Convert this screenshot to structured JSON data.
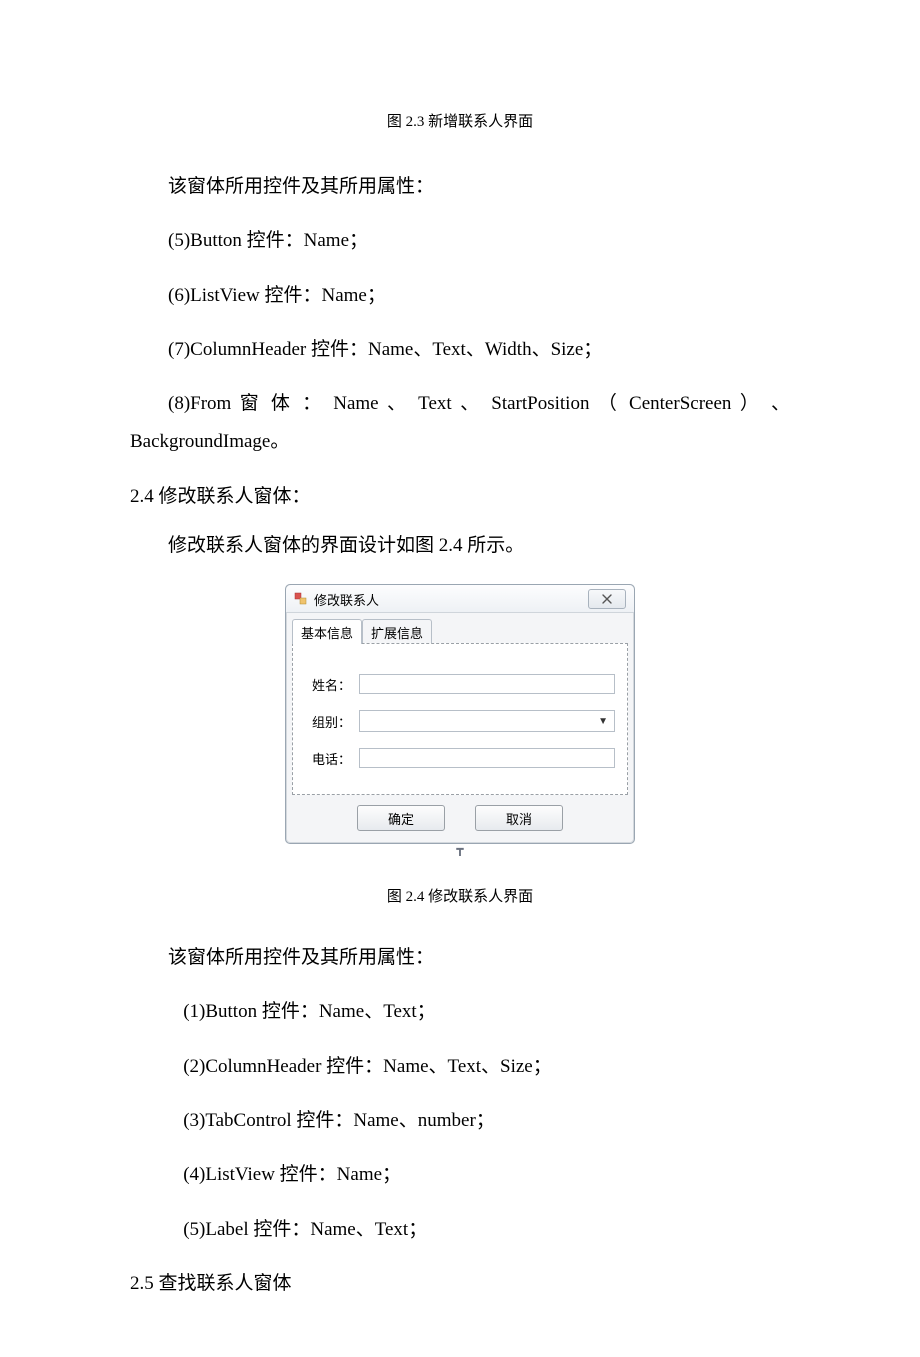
{
  "captions": {
    "fig23": "图 2.3  新增联系人界面",
    "fig24": "图 2.4    修改联系人界面"
  },
  "paras": {
    "p1": "该窗体所用控件及其所用属性：",
    "p2": "(5)Button 控件：Name；",
    "p3": "(6)ListView 控件：Name；",
    "p4": "(7)ColumnHeader 控件：Name、Text、Width、Size；",
    "p5a": "(8)From   窗 体 ：   Name  、  Text  、  StartPosition   （  CenterScreen  ） 、",
    "p5b": "BackgroundImage。",
    "s24": "2.4 修改联系人窗体：",
    "p6": "修改联系人窗体的界面设计如图 2.4 所示。",
    "p7": "该窗体所用控件及其所用属性：",
    "p8": "(1)Button 控件：Name、Text；",
    "p9": "(2)ColumnHeader 控件：Name、Text、Size；",
    "p10": "(3)TabControl 控件：Name、number；",
    "p11": "(4)ListView 控件：Name；",
    "p12": "(5)Label 控件：Name、Text；",
    "s25": "2.5 查找联系人窗体"
  },
  "winform": {
    "title": "修改联系人",
    "tabs": {
      "active": "基本信息",
      "inactive": "扩展信息"
    },
    "fields": {
      "name_label": "姓名：",
      "group_label": "组别：",
      "phone_label": "电话："
    },
    "buttons": {
      "ok": "确定",
      "cancel": "取消"
    }
  }
}
